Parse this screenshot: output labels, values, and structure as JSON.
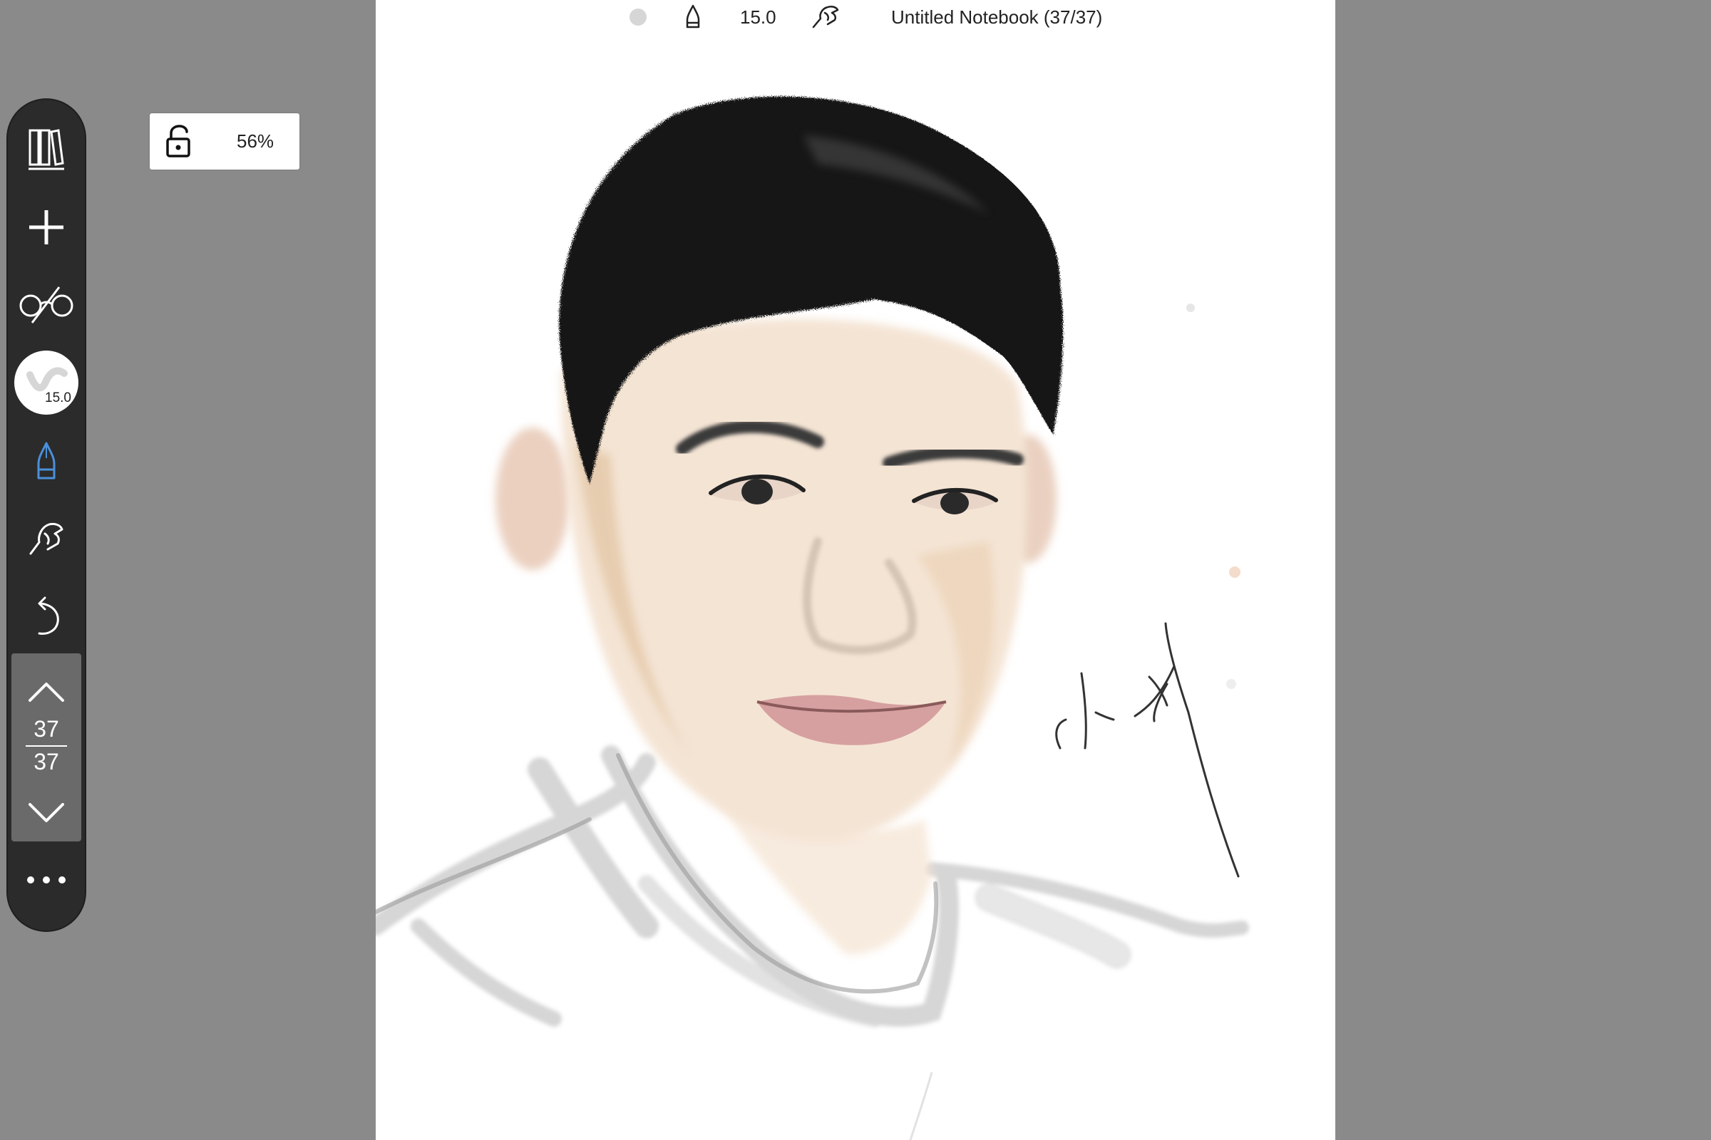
{
  "app": {
    "title": "Untitled Notebook (37/37)"
  },
  "topbar": {
    "pen_size": "15.0",
    "current_color": "#d6d6d6",
    "icons": [
      "color-dot",
      "pen-tip-icon",
      "gesture-hand-icon"
    ]
  },
  "toolbar": {
    "items": [
      {
        "name": "library",
        "icon": "books-icon"
      },
      {
        "name": "new-page",
        "icon": "plus-icon"
      },
      {
        "name": "view-mode",
        "icon": "glasses-icon"
      },
      {
        "name": "brush",
        "icon": "brush-preview",
        "size": "15.0"
      },
      {
        "name": "pen",
        "icon": "pen-tip-icon",
        "active": true,
        "color": "#4a90d9"
      },
      {
        "name": "gesture",
        "icon": "gesture-hand-icon"
      },
      {
        "name": "undo",
        "icon": "undo-icon"
      },
      {
        "name": "more",
        "icon": "more-dots-icon"
      }
    ],
    "pager": {
      "current": "37",
      "total": "37"
    }
  },
  "zoom": {
    "value": "56%",
    "locked": false
  },
  "canvas": {
    "background": "#ffffff",
    "content": "drawing"
  }
}
